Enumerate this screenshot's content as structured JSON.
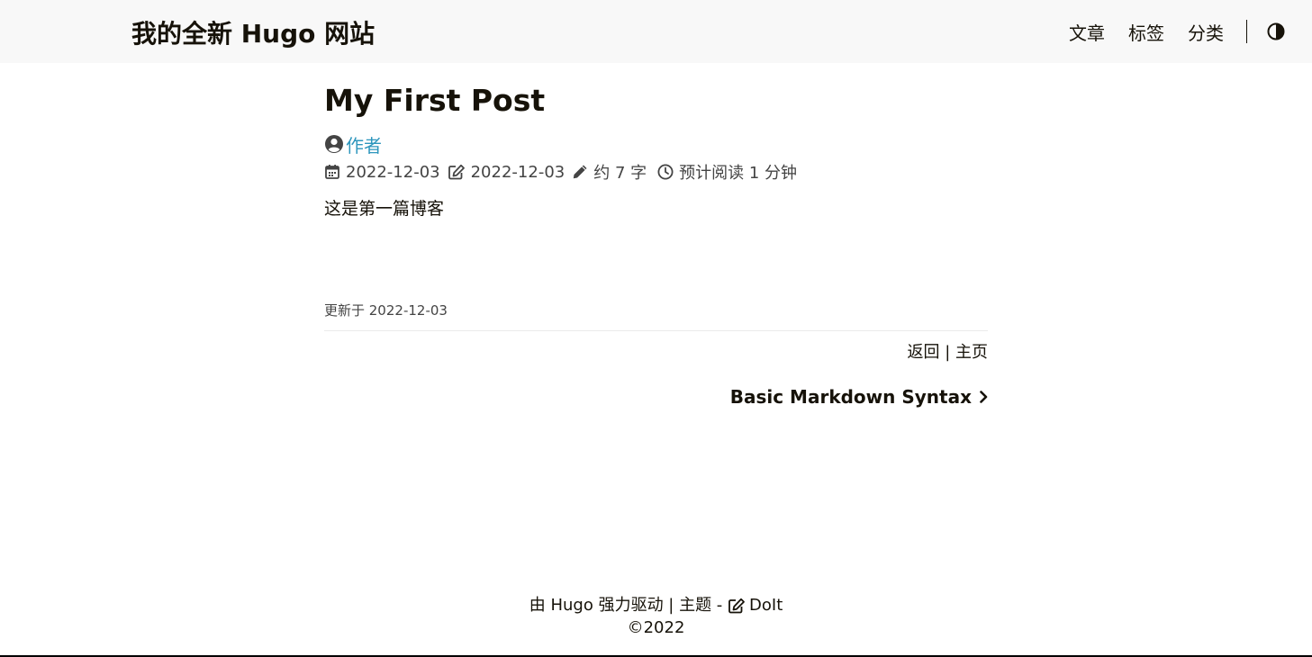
{
  "header": {
    "site_title": "我的全新 Hugo 网站",
    "nav": [
      {
        "label": "文章"
      },
      {
        "label": "标签"
      },
      {
        "label": "分类"
      }
    ],
    "theme_icon": "contrast-icon"
  },
  "post": {
    "title": "My First Post",
    "author": "作者",
    "published": "2022-12-03",
    "modified": "2022-12-03",
    "word_count": "约 7 字",
    "reading_time": "预计阅读 1 分钟",
    "content": "这是第一篇博客",
    "updated": "更新于 2022-12-03",
    "back": "返回",
    "home": "主页",
    "separator": "|",
    "next_post": "Basic Markdown Syntax"
  },
  "footer": {
    "powered_prefix": "由 ",
    "hugo": "Hugo",
    "powered_suffix": " 强力驱动 | 主题 - ",
    "theme_name": "DoIt",
    "copyright": "©2022"
  },
  "colors": {
    "accent": "#2d96bd",
    "text": "#161209",
    "header_bg": "#f8f8f8"
  }
}
